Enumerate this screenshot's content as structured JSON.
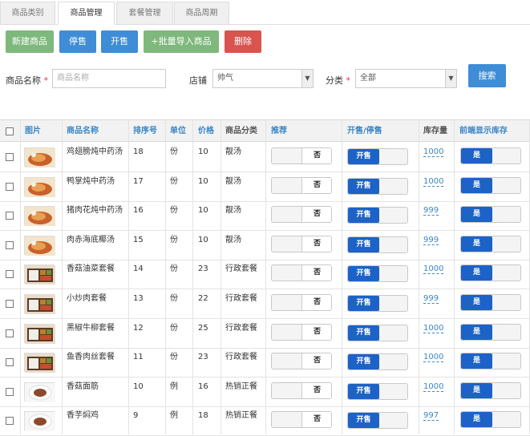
{
  "tabs": [
    "商品类别",
    "商品管理",
    "套餐管理",
    "商品周期"
  ],
  "toolbar": {
    "new": "新建商品",
    "stop": "停售",
    "start": "开售",
    "import": "+批量导入商品",
    "delete": "删除"
  },
  "filters": {
    "name_label": "商品名称",
    "name_placeholder": "商品名称",
    "store_label": "店铺",
    "store_value": "帅气",
    "category_label": "分类",
    "category_value": "全部",
    "required_mark": "*",
    "search": "搜索"
  },
  "table": {
    "headers": [
      "图片",
      "商品名称",
      "排序号",
      "单位",
      "价格",
      "商品分类",
      "推荐",
      "开售/停售",
      "库存量",
      "前端显示库存"
    ],
    "rows": [
      {
        "name": "鸡翅膀炖中药汤",
        "sort": "18",
        "unit": "份",
        "price": "10",
        "category": "靓汤",
        "recommend": "否",
        "sale": "开售",
        "stock": "1000",
        "show": "是",
        "img": "soup"
      },
      {
        "name": "鸭掌炖中药汤",
        "sort": "17",
        "unit": "份",
        "price": "10",
        "category": "靓汤",
        "recommend": "否",
        "sale": "开售",
        "stock": "1000",
        "show": "是",
        "img": "soup"
      },
      {
        "name": "猪肉花炖中药汤",
        "sort": "16",
        "unit": "份",
        "price": "10",
        "category": "靓汤",
        "recommend": "否",
        "sale": "开售",
        "stock": "999",
        "show": "是",
        "img": "soup"
      },
      {
        "name": "肉赤海底椰汤",
        "sort": "15",
        "unit": "份",
        "price": "10",
        "category": "靓汤",
        "recommend": "否",
        "sale": "开售",
        "stock": "999",
        "show": "是",
        "img": "soup"
      },
      {
        "name": "香菇油菜套餐",
        "sort": "14",
        "unit": "份",
        "price": "23",
        "category": "行政套餐",
        "recommend": "否",
        "sale": "开售",
        "stock": "1000",
        "show": "是",
        "img": "box"
      },
      {
        "name": "小炒肉套餐",
        "sort": "13",
        "unit": "份",
        "price": "22",
        "category": "行政套餐",
        "recommend": "否",
        "sale": "开售",
        "stock": "999",
        "show": "是",
        "img": "box"
      },
      {
        "name": "黑椒牛柳套餐",
        "sort": "12",
        "unit": "份",
        "price": "25",
        "category": "行政套餐",
        "recommend": "否",
        "sale": "开售",
        "stock": "1000",
        "show": "是",
        "img": "box"
      },
      {
        "name": "鱼香肉丝套餐",
        "sort": "11",
        "unit": "份",
        "price": "23",
        "category": "行政套餐",
        "recommend": "否",
        "sale": "开售",
        "stock": "1000",
        "show": "是",
        "img": "box"
      },
      {
        "name": "香菇面筋",
        "sort": "10",
        "unit": "例",
        "price": "16",
        "category": "热销正餐",
        "recommend": "否",
        "sale": "开售",
        "stock": "1000",
        "show": "是",
        "img": "plate"
      },
      {
        "name": "香芋焖鸡",
        "sort": "9",
        "unit": "例",
        "price": "18",
        "category": "热销正餐",
        "recommend": "否",
        "sale": "开售",
        "stock": "997",
        "show": "是",
        "img": "plate"
      }
    ]
  },
  "colors": {
    "accent": "#3a86c8",
    "green": "#7fb87c",
    "blue": "#3e8dd6",
    "red": "#d9534f",
    "toggle_on": "#1d62c7"
  }
}
